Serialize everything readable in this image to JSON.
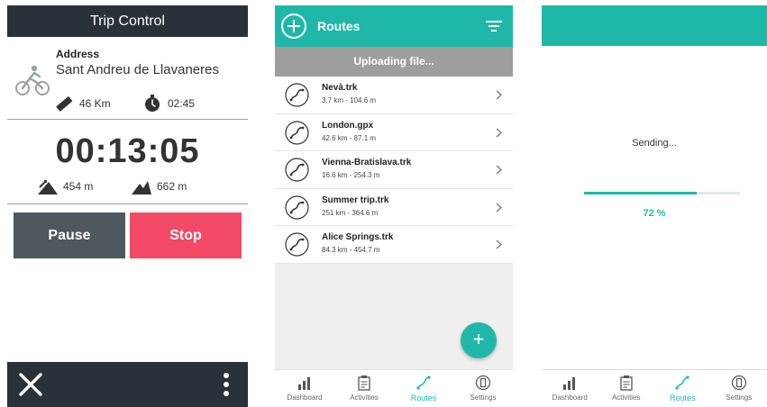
{
  "trip": {
    "title": "Trip Control",
    "address_label": "Address",
    "address_value": "Sant Andreu de Llavaneres",
    "distance": "46 Km",
    "time_remaining": "02:45",
    "elapsed": "00:13:05",
    "ascent": "454 m",
    "descent": "662 m",
    "pause_label": "Pause",
    "stop_label": "Stop",
    "accent": "#f24a66"
  },
  "routes": {
    "title": "Routes",
    "upload_status": "Uploading file...",
    "items": [
      {
        "name": "Nevà.trk",
        "meta": "3.7 km - 104.6 m"
      },
      {
        "name": "London.gpx",
        "meta": "42.6 km - 87.1 m"
      },
      {
        "name": "Vienna-Bratislava.trk",
        "meta": "16.6 km - 254.3 m"
      },
      {
        "name": "Summer trip.trk",
        "meta": "251 km - 364.6 m"
      },
      {
        "name": "Alice Springs.trk",
        "meta": "84.3 km - 454.7 m"
      }
    ],
    "fab_label": "+",
    "brand_color": "#1fb8a8"
  },
  "nav": {
    "dashboard": "Dashboard",
    "activities": "Activities",
    "routes": "Routes",
    "settings": "Settings"
  },
  "sending": {
    "status": "Sending...",
    "progress": 0.72,
    "progress_label": "72 %"
  }
}
